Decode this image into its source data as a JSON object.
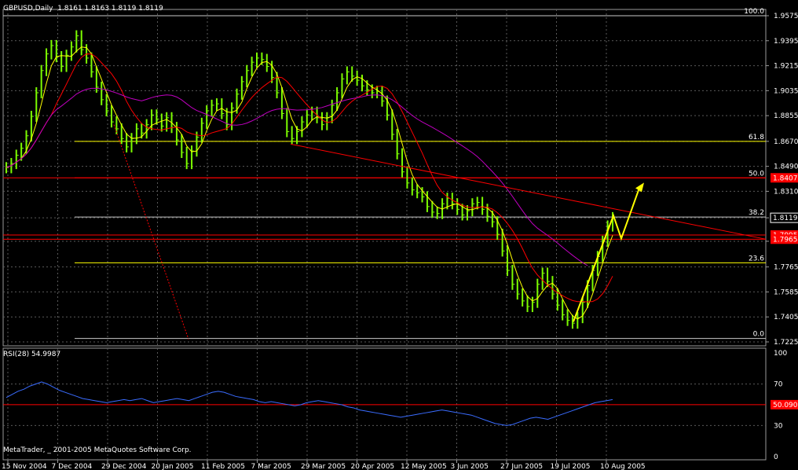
{
  "header": {
    "title": "GBPUSD,Daily",
    "ohlc": "1.8161 1.8163 1.8119 1.8119",
    "rsi_label": "RSI(28) 54.9987",
    "copyright": "MetaTrader, _ 2001-2005 MetaQuotes Software Corp."
  },
  "colors": {
    "background": "#000000",
    "grid": "#5a5a5a",
    "price_bars": "#7cfc00",
    "ma_fast": "#ffff00",
    "ma_mid": "#ff0000",
    "ma_slow": "#c000c0",
    "fib_level": "#ffff00",
    "resistance": "#ff0000",
    "rsi_line": "#3a6cff",
    "arrow": "#ffff00"
  },
  "chart_data": [
    {
      "type": "bar",
      "title": "GBPUSD,Daily",
      "x_tick_labels": [
        "15 Nov 2004",
        "7 Dec 2004",
        "29 Dec 2004",
        "20 Jan 2005",
        "11 Feb 2005",
        "7 Mar 2005",
        "29 Mar 2005",
        "20 Apr 2005",
        "12 May 2005",
        "3 Jun 2005",
        "27 Jun 2005",
        "19 Jul 2005",
        "10 Aug 2005"
      ],
      "y_tick_labels": [
        "1.9575",
        "1.9395",
        "1.9215",
        "1.9035",
        "1.8855",
        "1.8670",
        "1.8490",
        "1.8310",
        "1.8119",
        "1.7950",
        "1.7765",
        "1.7585",
        "1.7405",
        "1.7225"
      ],
      "ylim": [
        1.7225,
        1.9575
      ],
      "current_price": "1.8119",
      "price_tags": [
        "1.8407",
        "1.7995",
        "1.7965"
      ],
      "fib_labels": [
        "100.0",
        "61.8",
        "50.0",
        "38.2",
        "23.6",
        "0.0"
      ],
      "fib_values": [
        1.9575,
        1.867,
        1.8407,
        1.8125,
        1.7795,
        1.725
      ],
      "resistance_levels": [
        1.8407,
        1.7995,
        1.7965
      ],
      "trendline": {
        "start": [
          "7 Mar 2005",
          1.865
        ],
        "end": [
          "10 Aug 2005",
          1.7965
        ]
      },
      "projection_path": [
        [
          "19 Jul 2005",
          1.737
        ],
        [
          "10 Aug 2005",
          1.8135
        ],
        [
          "10 Aug 2005",
          1.797
        ],
        [
          "10 Aug 2005",
          1.835
        ]
      ],
      "series": [
        {
          "close": [
            1.848,
            1.851,
            1.857,
            1.862,
            1.871,
            1.885,
            1.902,
            1.918,
            1.93,
            1.936,
            1.928,
            1.921,
            1.929,
            1.935,
            1.943,
            1.933,
            1.927,
            1.917,
            1.906,
            1.897,
            1.889,
            1.881,
            1.876,
            1.869,
            1.863,
            1.869,
            1.876,
            1.873,
            1.879,
            1.886,
            1.883,
            1.878,
            1.884,
            1.877,
            1.868,
            1.859,
            1.851,
            1.86,
            1.87,
            1.88,
            1.889,
            1.893,
            1.894,
            1.887,
            1.879,
            1.891,
            1.901,
            1.91,
            1.918,
            1.924,
            1.927,
            1.926,
            1.921,
            1.913,
            1.902,
            1.887,
            1.874,
            1.869,
            1.874,
            1.881,
            1.886,
            1.888,
            1.884,
            1.879,
            1.884,
            1.893,
            1.902,
            1.912,
            1.917,
            1.914,
            1.911,
            1.907,
            1.904,
            1.902,
            1.903,
            1.896,
            1.886,
            1.872,
            1.858,
            1.845,
            1.837,
            1.832,
            1.83,
            1.827,
            1.82,
            1.816,
            1.815,
            1.822,
            1.826,
            1.822,
            1.818,
            1.814,
            1.817,
            1.822,
            1.823,
            1.818,
            1.813,
            1.809,
            1.8,
            1.788,
            1.774,
            1.764,
            1.757,
            1.752,
            1.748,
            1.751,
            1.764,
            1.772,
            1.766,
            1.757,
            1.749,
            1.742,
            1.738,
            1.736,
            1.74,
            1.751,
            1.763,
            1.774,
            1.784,
            1.795,
            1.806,
            1.812
          ]
        }
      ]
    },
    {
      "type": "line",
      "title": "RSI(28) 54.9987",
      "y_tick_labels": [
        "100",
        "70",
        "50.0908",
        "30",
        "0"
      ],
      "ylim": [
        0,
        100
      ],
      "level": 50.0908,
      "series": [
        {
          "values": [
            57,
            60,
            63,
            65,
            68,
            70,
            72,
            70,
            67,
            64,
            62,
            60,
            58,
            56,
            55,
            54,
            53,
            52,
            53,
            54,
            55,
            54,
            55,
            56,
            54,
            52,
            53,
            54,
            55,
            56,
            55,
            54,
            56,
            58,
            60,
            62,
            63,
            62,
            60,
            58,
            57,
            56,
            55,
            53,
            52,
            53,
            52,
            51,
            50,
            49,
            50,
            52,
            53,
            54,
            53,
            52,
            51,
            50,
            48,
            47,
            45,
            44,
            43,
            42,
            41,
            40,
            39,
            38,
            39,
            40,
            41,
            42,
            43,
            44,
            45,
            44,
            43,
            42,
            41,
            40,
            38,
            36,
            34,
            32,
            31,
            30,
            31,
            33,
            35,
            37,
            38,
            37,
            36,
            38,
            40,
            42,
            44,
            46,
            48,
            50,
            52,
            53,
            54,
            55
          ]
        }
      ]
    }
  ]
}
